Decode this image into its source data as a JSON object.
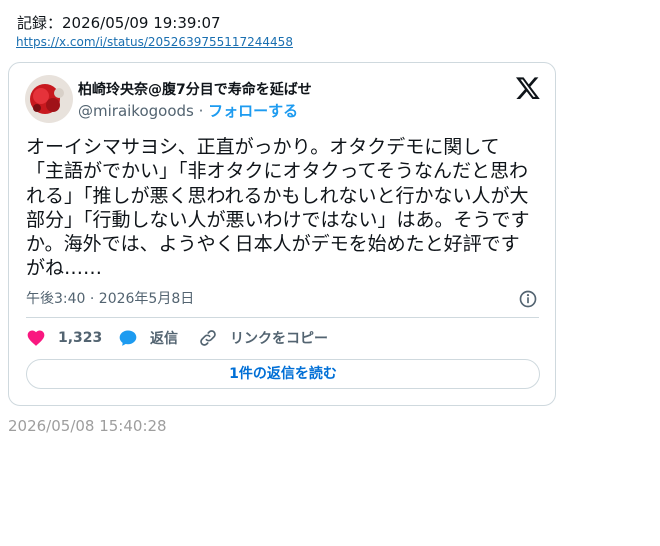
{
  "record": {
    "label": "記録：2026/05/09 19:39:07"
  },
  "source": {
    "url": "https://x.com/i/status/2052639755117244458"
  },
  "tweet": {
    "display_name": "柏崎玲央奈@腹7分目で寿命を延ばせ",
    "handle": "@miraikogoods",
    "separator": " · ",
    "follow_label": "フォローする",
    "text": "オーイシマサヨシ、正直がっかり。オタクデモに関して「主語がでかい」「非オタクにオタクってそうなんだと思われる」「推しが悪く思われるかもしれないと行かない人が大部分」「行動しない人が悪いわけではない」はあ。そうですか。海外では、ようやく日本人がデモを始めたと好評ですがね……",
    "timestamp": "午後3:40 · 2026年5月8日",
    "actions": {
      "like_count": "1,323",
      "reply_label": "返信",
      "copy_link_label": "リンクをコピー"
    },
    "read_replies_label": "1件の返信を読む"
  },
  "saved_at": "2026/05/08 15:40:28",
  "colors": {
    "like": "#f91880",
    "reply": "#1d9bf0",
    "follow": "#1d9bf0",
    "border": "#cfd9de",
    "muted": "#536471"
  },
  "icons": {
    "brand": "x-logo-icon",
    "info": "info-icon",
    "like": "heart-icon",
    "reply": "speech-bubble-icon",
    "copy": "link-icon"
  }
}
